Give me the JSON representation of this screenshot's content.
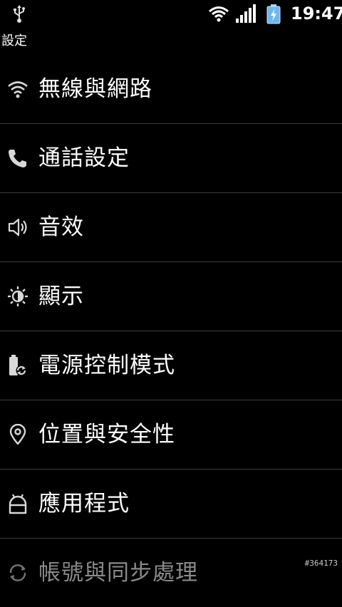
{
  "status_bar": {
    "time": "19:47",
    "icons": [
      "usb-icon",
      "wifi-icon",
      "signal-icon",
      "battery-charging-icon"
    ],
    "battery_color": "#7fc3ff"
  },
  "page": {
    "title": "設定"
  },
  "menu": {
    "items": [
      {
        "label": "無線與網路",
        "icon": "wifi-icon"
      },
      {
        "label": "通話設定",
        "icon": "phone-icon"
      },
      {
        "label": "音效",
        "icon": "speaker-icon"
      },
      {
        "label": "顯示",
        "icon": "brightness-icon"
      },
      {
        "label": "電源控制模式",
        "icon": "battery-recycle-icon"
      },
      {
        "label": "位置與安全性",
        "icon": "location-pin-icon"
      },
      {
        "label": "應用程式",
        "icon": "android-icon"
      },
      {
        "label": "帳號與同步處理",
        "icon": "sync-icon"
      }
    ]
  },
  "watermark": "#364173"
}
